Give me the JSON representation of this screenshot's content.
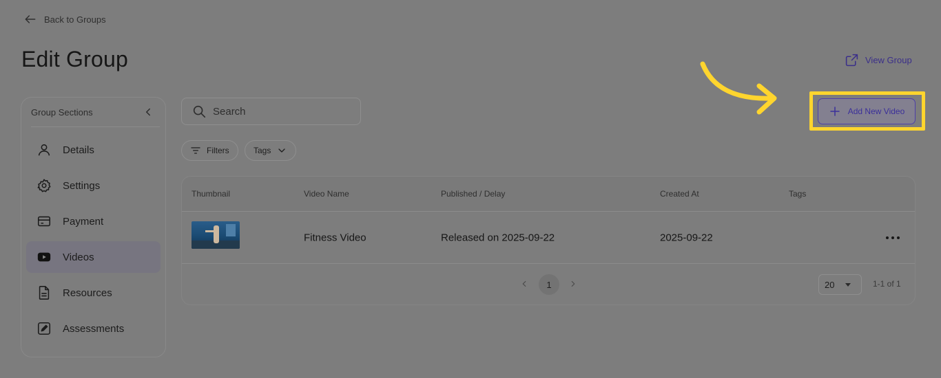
{
  "back_link": {
    "label": "Back to Groups",
    "icon": "arrow-left-icon"
  },
  "page": {
    "title": "Edit Group"
  },
  "view_group": {
    "label": "View Group",
    "icon": "external-link-icon"
  },
  "sidebar": {
    "title": "Group Sections",
    "items": [
      {
        "label": "Details",
        "icon": "user-icon",
        "active": false
      },
      {
        "label": "Settings",
        "icon": "gear-icon",
        "active": false
      },
      {
        "label": "Payment",
        "icon": "credit-card-icon",
        "active": false
      },
      {
        "label": "Videos",
        "icon": "youtube-icon",
        "active": true
      },
      {
        "label": "Resources",
        "icon": "document-icon",
        "active": false
      },
      {
        "label": "Assessments",
        "icon": "edit-square-icon",
        "active": false
      }
    ]
  },
  "search": {
    "placeholder": "Search",
    "value": ""
  },
  "filters": {
    "filters_label": "Filters",
    "tags_label": "Tags"
  },
  "add_button": {
    "label": "Add New Video",
    "icon": "plus-icon"
  },
  "table": {
    "columns": [
      "Thumbnail",
      "Video Name",
      "Published / Delay",
      "Created At",
      "Tags"
    ],
    "rows": [
      {
        "name": "Fitness Video",
        "published": "Released on 2025-09-22",
        "created_at": "2025-09-22",
        "tags": ""
      }
    ]
  },
  "pagination": {
    "current_page": "1",
    "per_page": "20",
    "range": "1-1 of 1"
  },
  "colors": {
    "highlight": "#ffd52e",
    "accent": "#3b2f9a",
    "overlay": "#7d7d7d"
  }
}
